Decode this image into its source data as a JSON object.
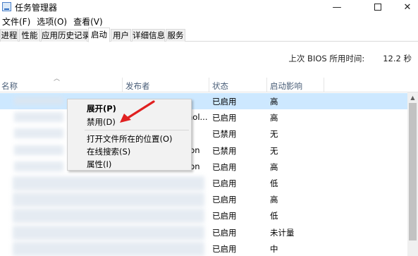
{
  "window": {
    "title": "任务管理器",
    "minimize_glyph": "—",
    "close_glyph": "✕"
  },
  "menu": [
    "文件(F)",
    "选项(O)",
    "查看(V)"
  ],
  "tabs": [
    {
      "label": "进程",
      "active": false
    },
    {
      "label": "性能",
      "active": false
    },
    {
      "label": "应用历史记录",
      "active": false
    },
    {
      "label": "启动",
      "active": true
    },
    {
      "label": "用户",
      "active": false
    },
    {
      "label": "详细信息",
      "active": false
    },
    {
      "label": "服务",
      "active": false
    }
  ],
  "bios": {
    "label": "上次 BIOS 所用时间:",
    "value": "12.2 秒"
  },
  "columns": {
    "name": "名称",
    "publisher": "发布者",
    "status": "状态",
    "impact": "启动影响"
  },
  "rows": [
    {
      "publisher_fragment": "",
      "status": "已启用",
      "impact": "高",
      "selected": true
    },
    {
      "publisher_fragment": "nol...",
      "status": "已启用",
      "impact": "高",
      "selected": false
    },
    {
      "publisher_fragment": "",
      "status": "已禁用",
      "impact": "无",
      "selected": false
    },
    {
      "publisher_fragment": "ion",
      "status": "已禁用",
      "impact": "无",
      "selected": false
    },
    {
      "publisher_fragment": "ion",
      "status": "已启用",
      "impact": "高",
      "selected": false
    },
    {
      "publisher_fragment": "",
      "status": "已启用",
      "impact": "低",
      "selected": false
    },
    {
      "publisher_fragment": "",
      "status": "已启用",
      "impact": "高",
      "selected": false
    },
    {
      "publisher_fragment": "",
      "status": "已启用",
      "impact": "低",
      "selected": false
    },
    {
      "publisher_fragment": "",
      "status": "已启用",
      "impact": "未计量",
      "selected": false
    },
    {
      "publisher_fragment": "",
      "status": "已启用",
      "impact": "中",
      "selected": false
    }
  ],
  "context_menu": {
    "expand": "展开(P)",
    "disable": "禁用(D)",
    "open_location": "打开文件所在的位置(O)",
    "search_online": "在线搜索(S)",
    "properties": "属性(I)"
  },
  "colors": {
    "selection": "#cde8ff",
    "annotation_arrow": "#e02020",
    "column_header_text": "#4c607a"
  }
}
